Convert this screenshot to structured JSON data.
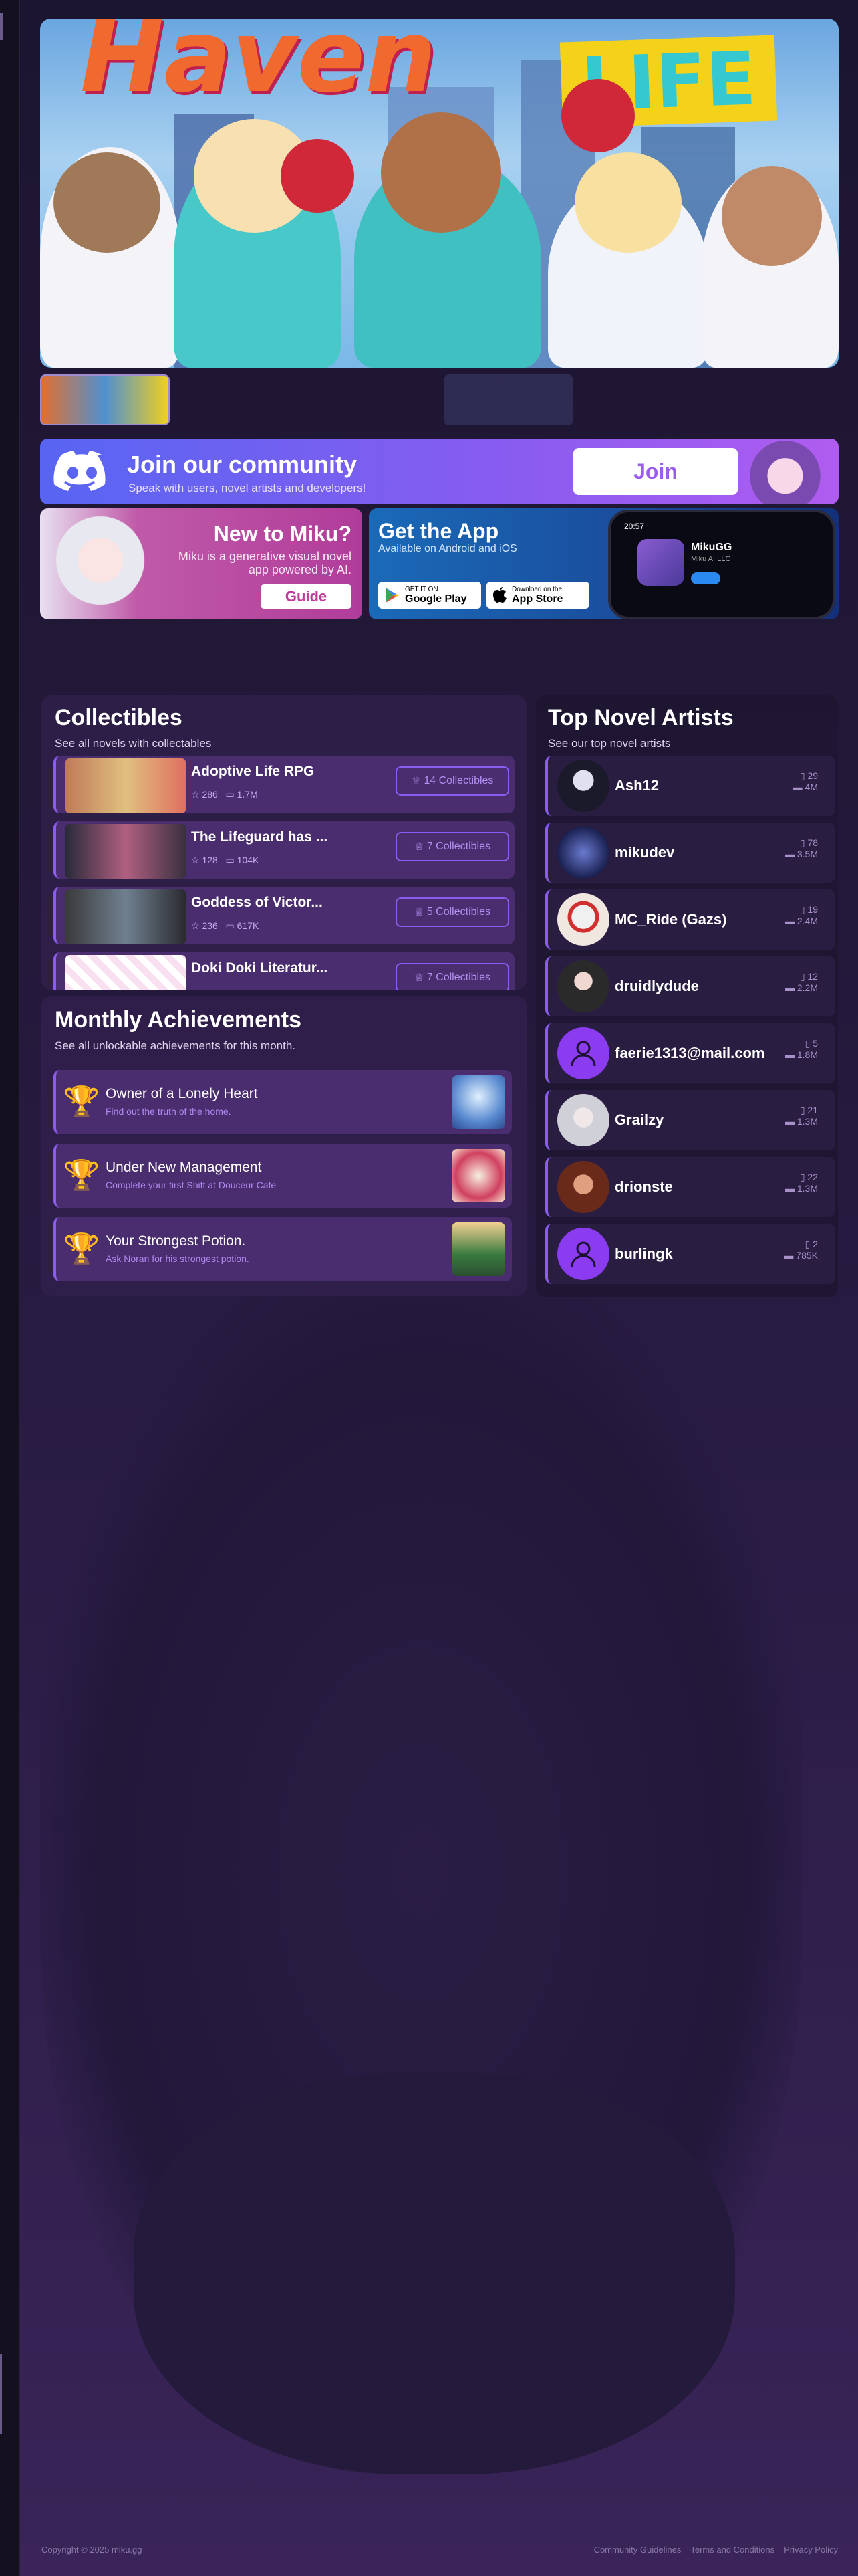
{
  "banner": {
    "title_left": "Haven",
    "title_right": "LIFE"
  },
  "discord": {
    "title": "Join our community",
    "subtitle": "Speak with users, novel artists and developers!",
    "button": "Join"
  },
  "miku_card": {
    "title": "New to Miku?",
    "description": "Miku is a generative visual novel app powered by AI.",
    "button": "Guide"
  },
  "app_card": {
    "title": "Get the App",
    "subtitle": "Available on Android and iOS",
    "google_small": "GET IT ON",
    "google_big": "Google Play",
    "apple_small": "Download on the",
    "apple_big": "App Store",
    "phone_time": "20:57",
    "phone_app": "MikuGG",
    "phone_dev": "Miku AI LLC"
  },
  "collectibles": {
    "title": "Collectibles",
    "subtitle": "See all novels with collectables",
    "items": [
      {
        "name": "Adoptive Life RPG",
        "stars": "286",
        "chats": "1.7M",
        "button": "14 Collectibles"
      },
      {
        "name": "The Lifeguard has ...",
        "stars": "128",
        "chats": "104K",
        "button": "7 Collectibles"
      },
      {
        "name": "Goddess of Victor...",
        "stars": "236",
        "chats": "617K",
        "button": "5 Collectibles"
      },
      {
        "name": "Doki Doki Literatur...",
        "stars": "",
        "chats": "",
        "button": "7 Collectibles"
      }
    ]
  },
  "achievements": {
    "title": "Monthly Achievements",
    "subtitle": "See all unlockable achievements for this month.",
    "items": [
      {
        "name": "Owner of a Lonely Heart",
        "desc": "Find out the truth of the home."
      },
      {
        "name": "Under New Management",
        "desc": "Complete your first Shift at Douceur Cafe"
      },
      {
        "name": "Your Strongest Potion.",
        "desc": "Ask Noran for his strongest potion."
      }
    ]
  },
  "artists": {
    "title": "Top Novel Artists",
    "subtitle": "See our top novel artists",
    "items": [
      {
        "name": "Ash12",
        "novels": "29",
        "chats": "4M"
      },
      {
        "name": "mikudev",
        "novels": "78",
        "chats": "3.5M"
      },
      {
        "name": "MC_Ride (Gazs)",
        "novels": "19",
        "chats": "2.4M"
      },
      {
        "name": "druidlydude",
        "novels": "12",
        "chats": "2.2M"
      },
      {
        "name": "faerie1313@mail.com",
        "novels": "5",
        "chats": "1.8M"
      },
      {
        "name": "Grailzy",
        "novels": "21",
        "chats": "1.3M"
      },
      {
        "name": "drionste",
        "novels": "22",
        "chats": "1.3M"
      },
      {
        "name": "burlingk",
        "novels": "2",
        "chats": "785K"
      }
    ]
  },
  "footer": {
    "copyright": "Copyright © 2025 miku.gg",
    "links": [
      "Community Guidelines",
      "Terms and Conditions",
      "Privacy Policy"
    ]
  }
}
